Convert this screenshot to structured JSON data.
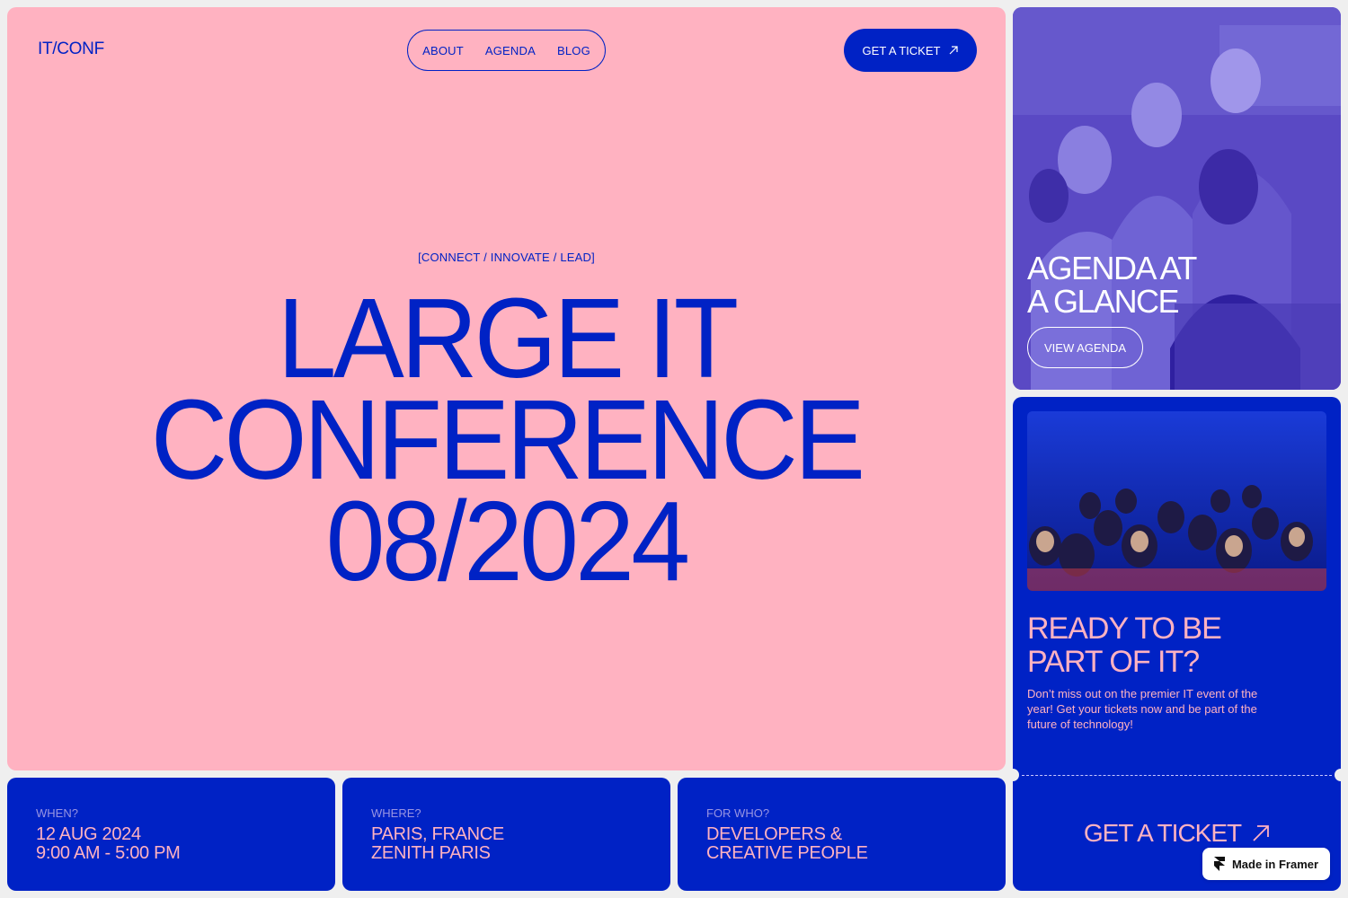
{
  "header": {
    "logo": "IT/CONF",
    "nav": [
      "ABOUT",
      "AGENDA",
      "BLOG"
    ],
    "cta": "GET A TICKET"
  },
  "hero": {
    "tagline": "[CONNECT / INNOVATE / LEAD]",
    "headline": [
      "LARGE IT",
      "CONFERENCE",
      "08/2024"
    ]
  },
  "info": [
    {
      "label": "WHEN?",
      "lines": [
        "12 AUG 2024",
        "9:00 AM - 5:00 PM"
      ]
    },
    {
      "label": "WHERE?",
      "lines": [
        "PARIS, FRANCE",
        "ZENITH PARIS"
      ]
    },
    {
      "label": "FOR WHO?",
      "lines": [
        "DEVELOPERS &",
        "CREATIVE PEOPLE"
      ]
    }
  ],
  "agenda_card": {
    "title": [
      "AGENDA AT",
      "A GLANCE"
    ],
    "button": "VIEW AGENDA"
  },
  "ticket_card": {
    "title": [
      "READY TO BE",
      "PART OF IT?"
    ],
    "description": "Don’t miss out on the premier IT event of the year! Get your tickets now and be part of the future of technology!",
    "cta": "GET A TICKET"
  },
  "badge": "Made in Framer",
  "colors": {
    "primary_blue": "#0022c5",
    "pink": "#ffb2c1",
    "background": "#efefef"
  },
  "icons": [
    "arrow-up-right-icon",
    "framer-logo-icon"
  ]
}
